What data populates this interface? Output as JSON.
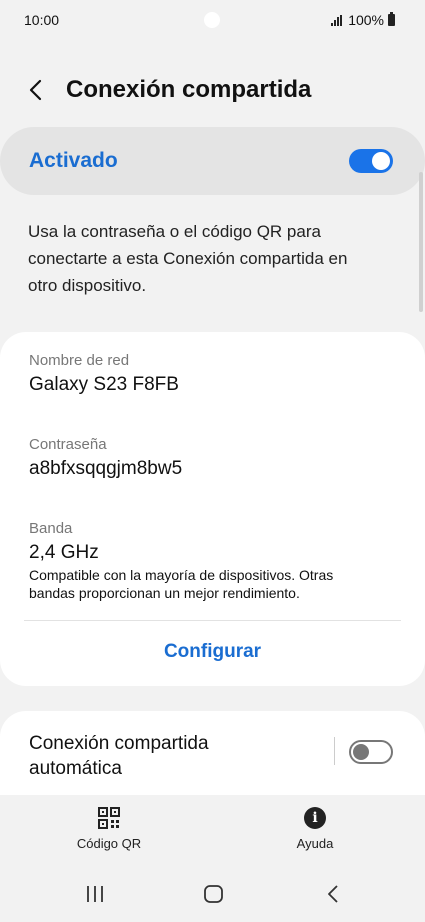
{
  "status_bar": {
    "time": "10:00",
    "battery": "100%"
  },
  "header": {
    "title": "Conexión compartida"
  },
  "master_switch": {
    "label": "Activado",
    "state": "on"
  },
  "description": "Usa la contraseña o el código QR para conectarte a esta Conexión compartida en otro dispositivo.",
  "network": {
    "name_label": "Nombre de red",
    "name_value": "Galaxy S23 F8FB",
    "password_label": "Contraseña",
    "password_value": "a8bfxsqqgjm8bw5",
    "band_label": "Banda",
    "band_value": "2,4 GHz",
    "band_note": "Compatible con la mayoría de dispositivos. Otras bandas proporcionan un mejor rendimiento.",
    "configure_label": "Configurar"
  },
  "auto_hotspot": {
    "label": "Conexión compartida automática",
    "state": "off"
  },
  "bottom_actions": {
    "qr_label": "Código QR",
    "help_label": "Ayuda"
  },
  "icons": {
    "back": "chevron-left-icon",
    "qr": "qr-code-icon",
    "help": "info-icon",
    "nav_recents": "recents-icon",
    "nav_home": "home-icon",
    "nav_back": "nav-back-icon"
  },
  "colors": {
    "accent": "#1a73e8",
    "accent_text": "#1a6dd1",
    "background": "#f2f2f2",
    "card": "#ffffff"
  }
}
